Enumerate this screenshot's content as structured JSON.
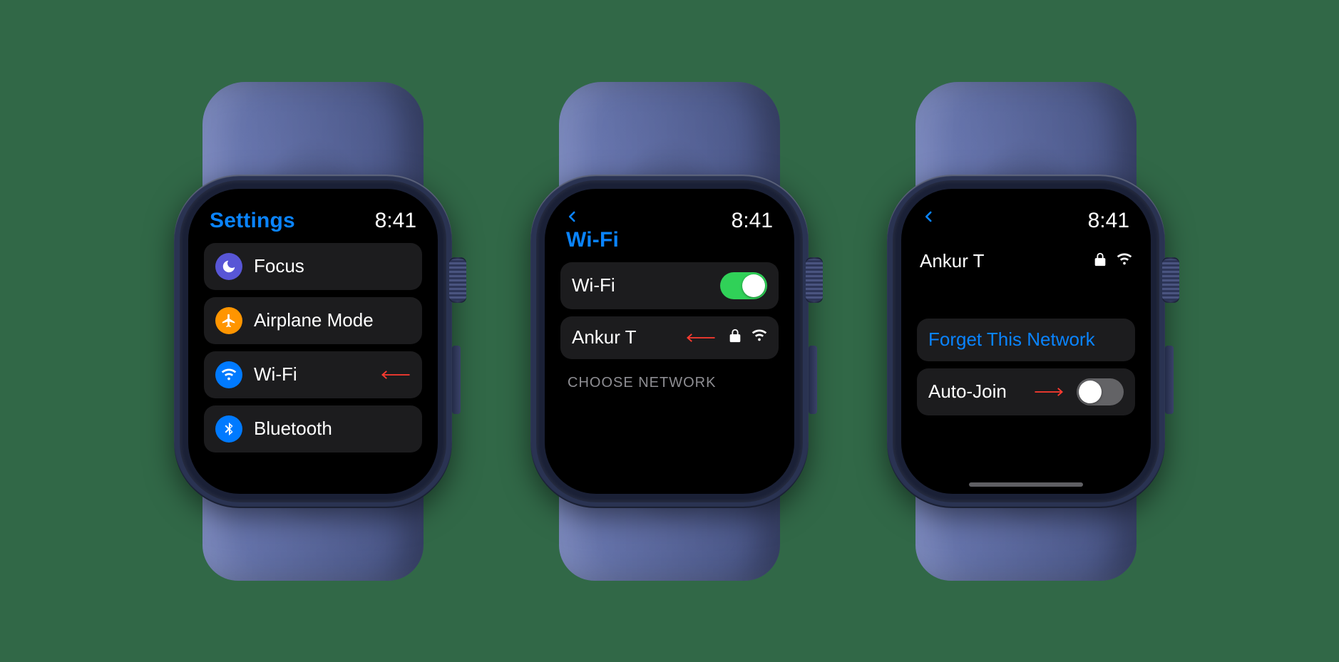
{
  "time": "8:41",
  "screens": {
    "settings": {
      "title": "Settings",
      "items": [
        {
          "label": "Focus",
          "icon": "moon",
          "color": "purple"
        },
        {
          "label": "Airplane Mode",
          "icon": "airplane",
          "color": "orange"
        },
        {
          "label": "Wi-Fi",
          "icon": "wifi",
          "color": "blue",
          "pointer": true
        },
        {
          "label": "Bluetooth",
          "icon": "bluetooth",
          "color": "blue"
        }
      ]
    },
    "wifi_list": {
      "title": "Wi-Fi",
      "toggle_label": "Wi-Fi",
      "toggle_on": true,
      "network": {
        "name": "Ankur T",
        "locked": true,
        "pointer": true
      },
      "section": "CHOOSE NETWORK"
    },
    "wifi_detail": {
      "network_name": "Ankur T",
      "locked": true,
      "forget_label": "Forget This Network",
      "autojoin_label": "Auto-Join",
      "autojoin_on": false,
      "pointer": true
    }
  }
}
